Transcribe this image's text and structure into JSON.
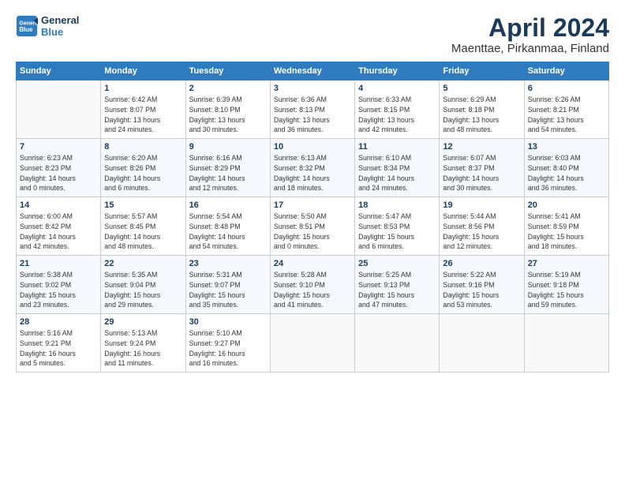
{
  "logo": {
    "line1": "General",
    "line2": "Blue"
  },
  "title": "April 2024",
  "subtitle": "Maenttae, Pirkanmaa, Finland",
  "weekdays": [
    "Sunday",
    "Monday",
    "Tuesday",
    "Wednesday",
    "Thursday",
    "Friday",
    "Saturday"
  ],
  "weeks": [
    [
      {
        "date": "",
        "info": ""
      },
      {
        "date": "1",
        "info": "Sunrise: 6:42 AM\nSunset: 8:07 PM\nDaylight: 13 hours\nand 24 minutes."
      },
      {
        "date": "2",
        "info": "Sunrise: 6:39 AM\nSunset: 8:10 PM\nDaylight: 13 hours\nand 30 minutes."
      },
      {
        "date": "3",
        "info": "Sunrise: 6:36 AM\nSunset: 8:13 PM\nDaylight: 13 hours\nand 36 minutes."
      },
      {
        "date": "4",
        "info": "Sunrise: 6:33 AM\nSunset: 8:15 PM\nDaylight: 13 hours\nand 42 minutes."
      },
      {
        "date": "5",
        "info": "Sunrise: 6:29 AM\nSunset: 8:18 PM\nDaylight: 13 hours\nand 48 minutes."
      },
      {
        "date": "6",
        "info": "Sunrise: 6:26 AM\nSunset: 8:21 PM\nDaylight: 13 hours\nand 54 minutes."
      }
    ],
    [
      {
        "date": "7",
        "info": "Sunrise: 6:23 AM\nSunset: 8:23 PM\nDaylight: 14 hours\nand 0 minutes."
      },
      {
        "date": "8",
        "info": "Sunrise: 6:20 AM\nSunset: 8:26 PM\nDaylight: 14 hours\nand 6 minutes."
      },
      {
        "date": "9",
        "info": "Sunrise: 6:16 AM\nSunset: 8:29 PM\nDaylight: 14 hours\nand 12 minutes."
      },
      {
        "date": "10",
        "info": "Sunrise: 6:13 AM\nSunset: 8:32 PM\nDaylight: 14 hours\nand 18 minutes."
      },
      {
        "date": "11",
        "info": "Sunrise: 6:10 AM\nSunset: 8:34 PM\nDaylight: 14 hours\nand 24 minutes."
      },
      {
        "date": "12",
        "info": "Sunrise: 6:07 AM\nSunset: 8:37 PM\nDaylight: 14 hours\nand 30 minutes."
      },
      {
        "date": "13",
        "info": "Sunrise: 6:03 AM\nSunset: 8:40 PM\nDaylight: 14 hours\nand 36 minutes."
      }
    ],
    [
      {
        "date": "14",
        "info": "Sunrise: 6:00 AM\nSunset: 8:42 PM\nDaylight: 14 hours\nand 42 minutes."
      },
      {
        "date": "15",
        "info": "Sunrise: 5:57 AM\nSunset: 8:45 PM\nDaylight: 14 hours\nand 48 minutes."
      },
      {
        "date": "16",
        "info": "Sunrise: 5:54 AM\nSunset: 8:48 PM\nDaylight: 14 hours\nand 54 minutes."
      },
      {
        "date": "17",
        "info": "Sunrise: 5:50 AM\nSunset: 8:51 PM\nDaylight: 15 hours\nand 0 minutes."
      },
      {
        "date": "18",
        "info": "Sunrise: 5:47 AM\nSunset: 8:53 PM\nDaylight: 15 hours\nand 6 minutes."
      },
      {
        "date": "19",
        "info": "Sunrise: 5:44 AM\nSunset: 8:56 PM\nDaylight: 15 hours\nand 12 minutes."
      },
      {
        "date": "20",
        "info": "Sunrise: 5:41 AM\nSunset: 8:59 PM\nDaylight: 15 hours\nand 18 minutes."
      }
    ],
    [
      {
        "date": "21",
        "info": "Sunrise: 5:38 AM\nSunset: 9:02 PM\nDaylight: 15 hours\nand 23 minutes."
      },
      {
        "date": "22",
        "info": "Sunrise: 5:35 AM\nSunset: 9:04 PM\nDaylight: 15 hours\nand 29 minutes."
      },
      {
        "date": "23",
        "info": "Sunrise: 5:31 AM\nSunset: 9:07 PM\nDaylight: 15 hours\nand 35 minutes."
      },
      {
        "date": "24",
        "info": "Sunrise: 5:28 AM\nSunset: 9:10 PM\nDaylight: 15 hours\nand 41 minutes."
      },
      {
        "date": "25",
        "info": "Sunrise: 5:25 AM\nSunset: 9:13 PM\nDaylight: 15 hours\nand 47 minutes."
      },
      {
        "date": "26",
        "info": "Sunrise: 5:22 AM\nSunset: 9:16 PM\nDaylight: 15 hours\nand 53 minutes."
      },
      {
        "date": "27",
        "info": "Sunrise: 5:19 AM\nSunset: 9:18 PM\nDaylight: 15 hours\nand 59 minutes."
      }
    ],
    [
      {
        "date": "28",
        "info": "Sunrise: 5:16 AM\nSunset: 9:21 PM\nDaylight: 16 hours\nand 5 minutes."
      },
      {
        "date": "29",
        "info": "Sunrise: 5:13 AM\nSunset: 9:24 PM\nDaylight: 16 hours\nand 11 minutes."
      },
      {
        "date": "30",
        "info": "Sunrise: 5:10 AM\nSunset: 9:27 PM\nDaylight: 16 hours\nand 16 minutes."
      },
      {
        "date": "",
        "info": ""
      },
      {
        "date": "",
        "info": ""
      },
      {
        "date": "",
        "info": ""
      },
      {
        "date": "",
        "info": ""
      }
    ]
  ]
}
